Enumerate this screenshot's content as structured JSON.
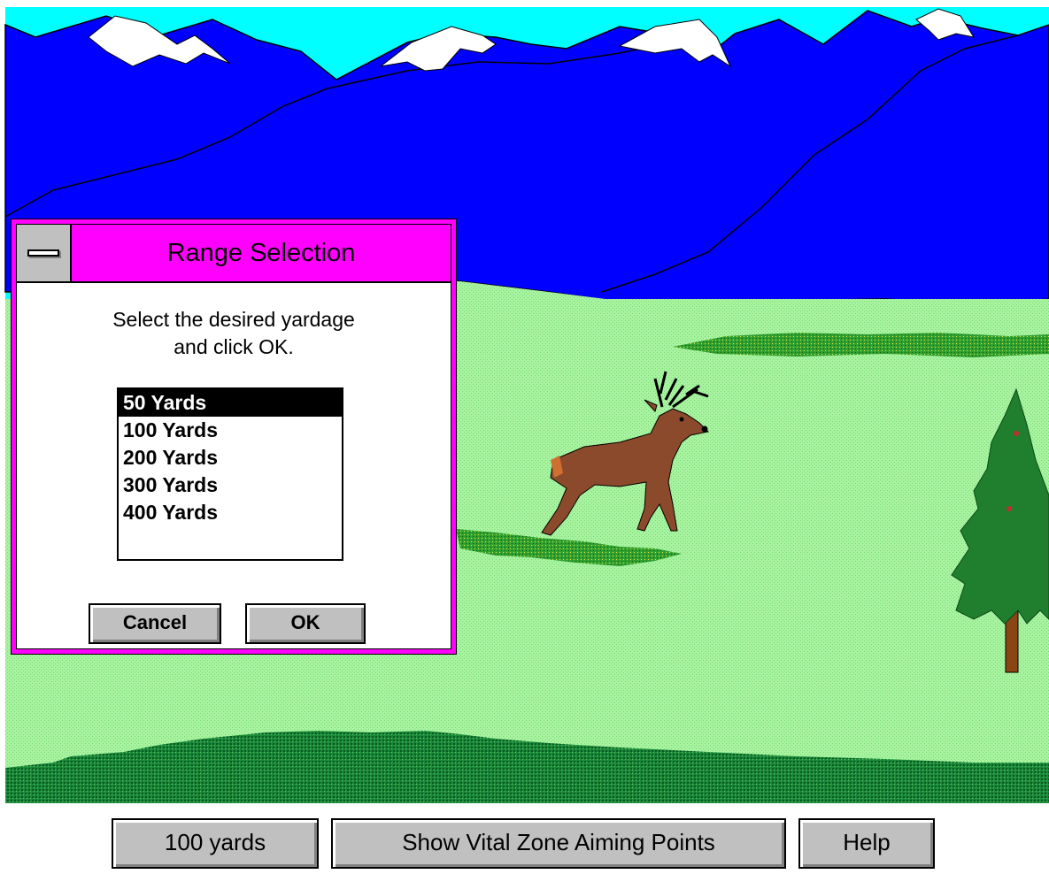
{
  "dialog": {
    "title": "Range Selection",
    "prompt": "Select the desired yardage\nand click OK.",
    "options": [
      "50 Yards",
      "100 Yards",
      "200 Yards",
      "300 Yards",
      "400 Yards"
    ],
    "selected_index": 0,
    "cancel_label": "Cancel",
    "ok_label": "OK"
  },
  "toolbar": {
    "range_label": "100 yards",
    "vital_zone_label": "Show Vital Zone Aiming Points",
    "help_label": "Help"
  },
  "colors": {
    "sky": "#00ffff",
    "mountains": "#0000ff",
    "snow": "#ffffff",
    "grass": "#a8f0a0",
    "dialog_frame": "#ff00ff",
    "button_face": "#c0c0c0"
  }
}
